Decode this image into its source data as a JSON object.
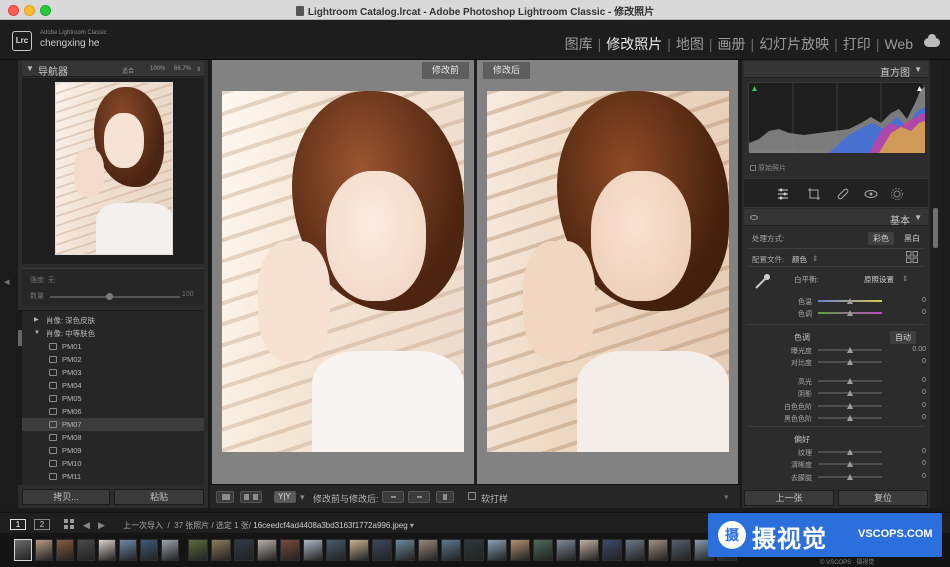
{
  "window": {
    "title": "Lightroom Catalog.lrcat - Adobe Photoshop Lightroom Classic - 修改照片"
  },
  "header": {
    "logo": "Lrc",
    "app_name": "Adobe Lightroom Classic",
    "user": "chengxing he",
    "modules": [
      "图库",
      "修改照片",
      "地图",
      "画册",
      "幻灯片放映",
      "打印",
      "Web"
    ],
    "active_module": "修改照片",
    "separator": "|"
  },
  "navigator": {
    "title": "导航器",
    "zoom_fit": "适合",
    "zoom_100": "100%",
    "zoom_667": "66.7%",
    "zoom_menu": "⇕",
    "tone_label": "强度: 无",
    "amount_label": "数量",
    "amount_value": "100"
  },
  "presets": {
    "items": [
      {
        "kind": "group",
        "tri": "▶",
        "label": "肖像: 深色皮肤"
      },
      {
        "kind": "group",
        "tri": "▼",
        "label": "肖像: 中等肤色"
      },
      {
        "kind": "preset",
        "label": "PM01"
      },
      {
        "kind": "preset",
        "label": "PM02"
      },
      {
        "kind": "preset",
        "label": "PM03"
      },
      {
        "kind": "preset",
        "label": "PM04"
      },
      {
        "kind": "preset",
        "label": "PM05"
      },
      {
        "kind": "preset",
        "label": "PM06"
      },
      {
        "kind": "preset",
        "label": "PM07",
        "selected": true
      },
      {
        "kind": "preset",
        "label": "PM08"
      },
      {
        "kind": "preset",
        "label": "PM09"
      },
      {
        "kind": "preset",
        "label": "PM10"
      },
      {
        "kind": "preset",
        "label": "PM11"
      }
    ]
  },
  "left_buttons": {
    "copy": "拷贝...",
    "paste": "粘贴"
  },
  "compare": {
    "before": "修改前",
    "after": "修改后"
  },
  "toolbar": {
    "before_after_label": "修改前与修改后:",
    "soft_proof": "软打样",
    "ab_label": "Y|Y",
    "arrow": "▾"
  },
  "histogram": {
    "title": "直方图",
    "original_photo": "原始照片"
  },
  "basic": {
    "title": "基本",
    "treatment_label": "处理方式:",
    "treatment_color": "彩色",
    "treatment_bw": "黑白",
    "profile_label": "配置文件:",
    "profile_value": "颜色",
    "profile_arrow": "⇕",
    "wb_label": "白平衡:",
    "wb_value": "原照设置",
    "tone_label": "色调",
    "auto": "自动",
    "presence_label": "偏好",
    "sliders": [
      {
        "label": "色温",
        "value": "0",
        "pos": 0.5
      },
      {
        "label": "色调",
        "value": "0",
        "pos": 0.5
      },
      {
        "label": "曝光度",
        "value": "0.00",
        "pos": 0.5
      },
      {
        "label": "对比度",
        "value": "0",
        "pos": 0.5
      },
      {
        "label": "高光",
        "value": "0",
        "pos": 0.5
      },
      {
        "label": "阴影",
        "value": "0",
        "pos": 0.5
      },
      {
        "label": "白色色阶",
        "value": "0",
        "pos": 0.5
      },
      {
        "label": "黑色色阶",
        "value": "0",
        "pos": 0.5
      },
      {
        "label": "纹理",
        "value": "0",
        "pos": 0.5
      },
      {
        "label": "清晰度",
        "value": "0",
        "pos": 0.5
      },
      {
        "label": "去朦胧",
        "value": "0",
        "pos": 0.5
      }
    ]
  },
  "right_buttons": {
    "previous": "上一张",
    "reset": "复位"
  },
  "filmbar": {
    "page1": "1",
    "page2": "2",
    "source": "上一次导入",
    "count": "37 张照片 / 选定 1 张/",
    "filename": "16ceedcf4ad4408a3bd3163f1772a996.jpeg",
    "file_arrow": "▾"
  },
  "watermark": {
    "logo": "摄",
    "cn": "摄视觉",
    "en": "VSCOPS.COM",
    "sub": "© VSCOPS · 摄视觉"
  },
  "colors": {
    "accent": "#2a6fdb",
    "panel": "#2c2c2c",
    "background": "#1a1a1a"
  }
}
